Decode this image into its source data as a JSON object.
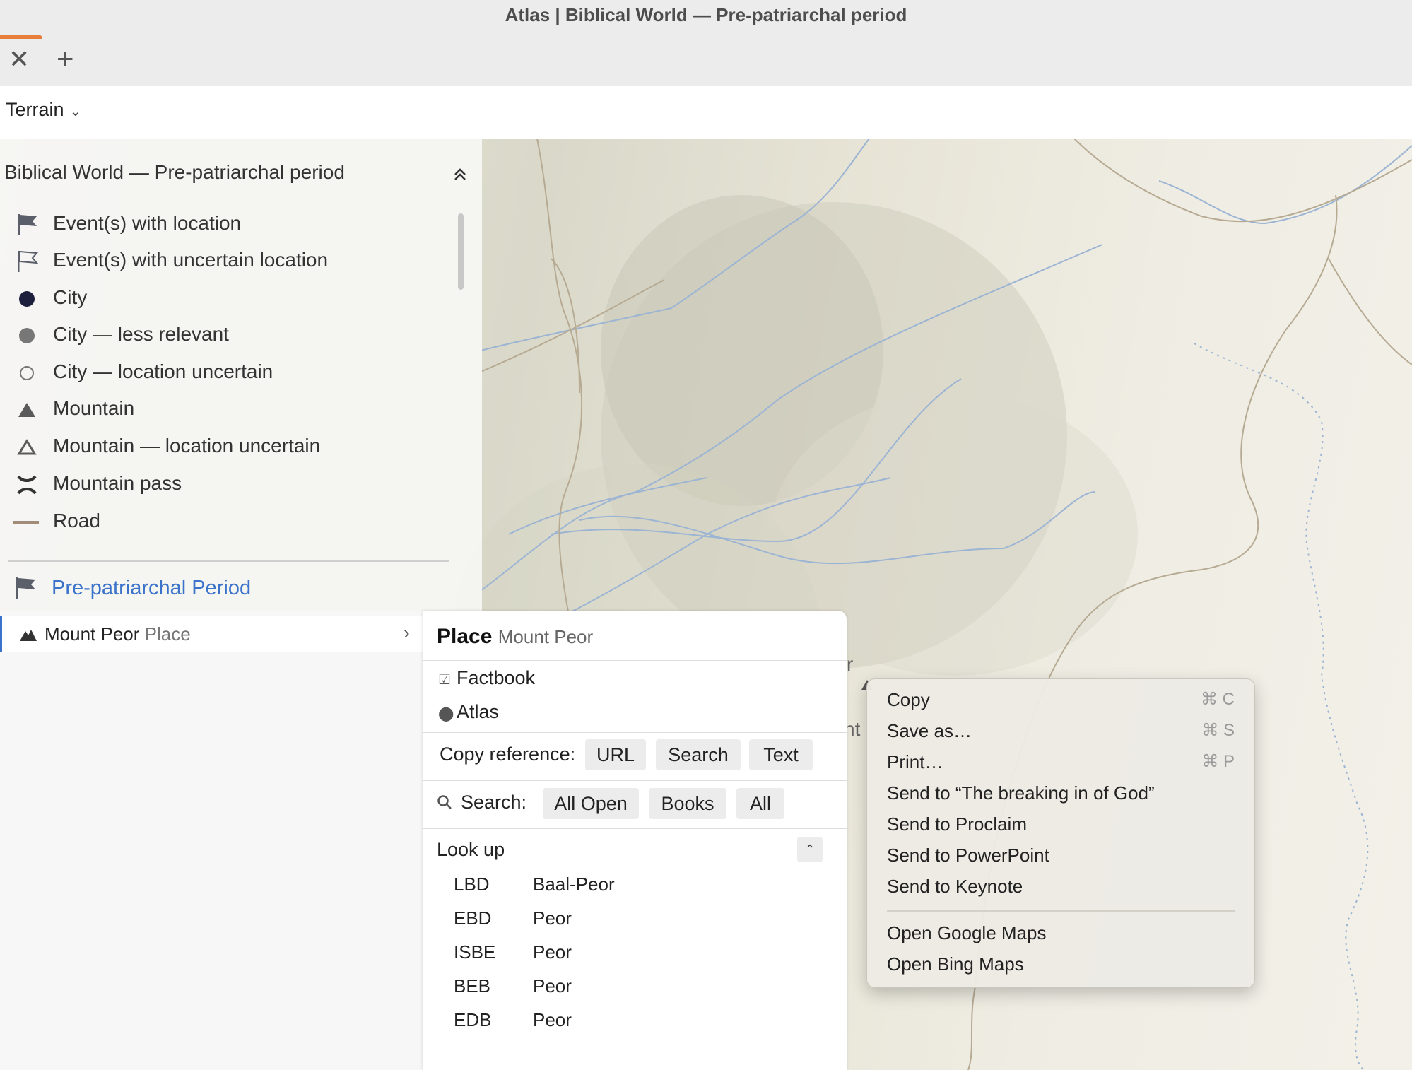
{
  "window": {
    "title": "Atlas | Biblical World — Pre-patriarchal period"
  },
  "tabs": {
    "close": "✕",
    "add": "+"
  },
  "toolbar": {
    "layer": "Terrain"
  },
  "legend": {
    "title": "Biblical World — Pre-patriarchal period",
    "items": [
      {
        "label": "Event(s) with location",
        "icon": "flag-filled-icon"
      },
      {
        "label": "Event(s) with uncertain location",
        "icon": "flag-outline-icon"
      },
      {
        "label": "City",
        "icon": "city-dot-icon"
      },
      {
        "label": "City — less relevant",
        "icon": "city-gray-dot-icon"
      },
      {
        "label": "City — location uncertain",
        "icon": "city-hollow-dot-icon"
      },
      {
        "label": "Mountain",
        "icon": "mountain-icon"
      },
      {
        "label": "Mountain — location uncertain",
        "icon": "mountain-outline-icon"
      },
      {
        "label": "Mountain pass",
        "icon": "mountain-pass-icon"
      },
      {
        "label": "Road",
        "icon": "road-icon"
      }
    ],
    "period_link": "Pre-patriarchal Period"
  },
  "place_list": {
    "name": "Mount Peor",
    "type": "Place"
  },
  "card": {
    "heading": "Place",
    "subheading": "Mount Peor",
    "links": [
      "Factbook",
      "Atlas"
    ],
    "copy_label": "Copy reference:",
    "copy_buttons": [
      "URL",
      "Search",
      "Text"
    ],
    "search_label": "Search:",
    "search_buttons": [
      "All Open",
      "Books",
      "All"
    ],
    "lookup_title": "Look up",
    "lookup": [
      {
        "abbr": "LBD",
        "value": "Baal-Peor"
      },
      {
        "abbr": "EBD",
        "value": "Peor"
      },
      {
        "abbr": "ISBE",
        "value": "Peor"
      },
      {
        "abbr": "BEB",
        "value": "Peor"
      },
      {
        "abbr": "EDB",
        "value": "Peor"
      }
    ]
  },
  "map_labels": {
    "partial1": "r",
    "partial2": "nt"
  },
  "context_menu": {
    "items": [
      {
        "label": "Copy",
        "shortcut": "⌘ C"
      },
      {
        "label": "Save as…",
        "shortcut": "⌘ S"
      },
      {
        "label": "Print…",
        "shortcut": "⌘ P"
      },
      {
        "label": "Send to “The breaking in of God”",
        "shortcut": ""
      },
      {
        "label": "Send to Proclaim",
        "shortcut": ""
      },
      {
        "label": "Send to PowerPoint",
        "shortcut": ""
      },
      {
        "label": "Send to Keynote",
        "shortcut": ""
      }
    ],
    "items2": [
      {
        "label": "Open Google Maps"
      },
      {
        "label": "Open Bing Maps"
      }
    ]
  },
  "colors": {
    "accent": "#3a73c9",
    "tab_accent": "#e67e3a"
  }
}
